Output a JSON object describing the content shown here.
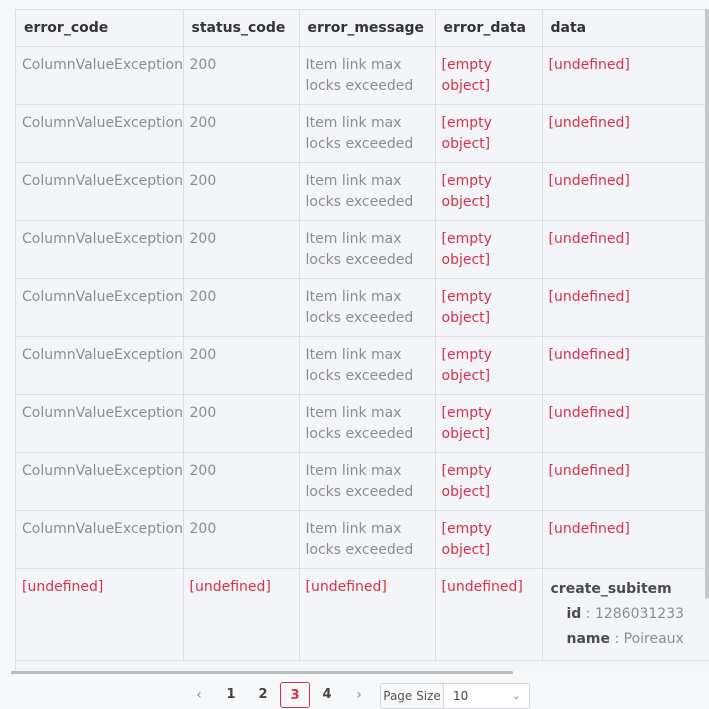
{
  "table": {
    "columns": [
      "error_code",
      "status_code",
      "error_message",
      "error_data",
      "data"
    ],
    "rows": [
      {
        "error_code": "ColumnValueException",
        "status_code": "200",
        "error_message": "Item link max locks exceeded",
        "error_data": "[empty object]",
        "data": "[undefined]"
      },
      {
        "error_code": "ColumnValueException",
        "status_code": "200",
        "error_message": "Item link max locks exceeded",
        "error_data": "[empty object]",
        "data": "[undefined]"
      },
      {
        "error_code": "ColumnValueException",
        "status_code": "200",
        "error_message": "Item link max locks exceeded",
        "error_data": "[empty object]",
        "data": "[undefined]"
      },
      {
        "error_code": "ColumnValueException",
        "status_code": "200",
        "error_message": "Item link max locks exceeded",
        "error_data": "[empty object]",
        "data": "[undefined]"
      },
      {
        "error_code": "ColumnValueException",
        "status_code": "200",
        "error_message": "Item link max locks exceeded",
        "error_data": "[empty object]",
        "data": "[undefined]"
      },
      {
        "error_code": "ColumnValueException",
        "status_code": "200",
        "error_message": "Item link max locks exceeded",
        "error_data": "[empty object]",
        "data": "[undefined]"
      },
      {
        "error_code": "ColumnValueException",
        "status_code": "200",
        "error_message": "Item link max locks exceeded",
        "error_data": "[empty object]",
        "data": "[undefined]"
      },
      {
        "error_code": "ColumnValueException",
        "status_code": "200",
        "error_message": "Item link max locks exceeded",
        "error_data": "[empty object]",
        "data": "[undefined]"
      },
      {
        "error_code": "ColumnValueException",
        "status_code": "200",
        "error_message": "Item link max locks exceeded",
        "error_data": "[empty object]",
        "data": "[undefined]"
      }
    ],
    "last_row": {
      "error_code": "[undefined]",
      "status_code": "[undefined]",
      "error_message": "[undefined]",
      "error_data": "[undefined]",
      "data": {
        "title": "create_subitem",
        "fields": [
          {
            "key": "id",
            "sep": " : ",
            "value": "1286031233"
          },
          {
            "key": "name",
            "sep": " : ",
            "value": "Poireaux"
          }
        ]
      }
    }
  },
  "pagination": {
    "prev_icon": "chevron-left-icon",
    "next_icon": "chevron-right-icon",
    "pages": [
      "1",
      "2",
      "3",
      "4"
    ],
    "current_page": "3",
    "page_size_label": "Page Size",
    "page_size_value": "10"
  },
  "colors": {
    "accent": "#d6314a",
    "muted_text": "#8a8c93",
    "header_text": "#323338"
  }
}
